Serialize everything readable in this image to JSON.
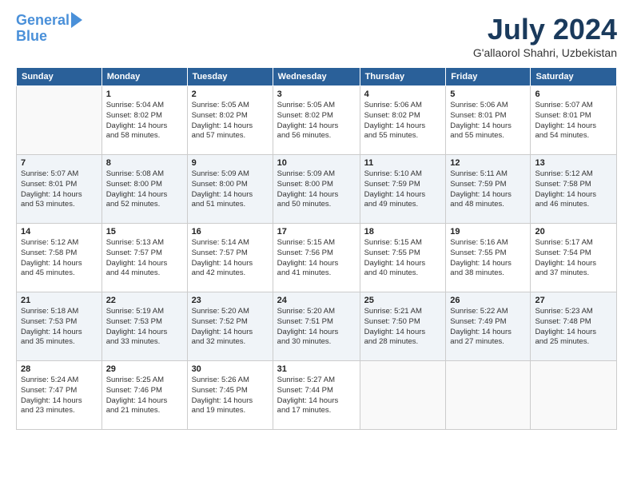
{
  "logo": {
    "line1": "General",
    "line2": "Blue"
  },
  "title": "July 2024",
  "location": "G'allaorol Shahri, Uzbekistan",
  "headers": [
    "Sunday",
    "Monday",
    "Tuesday",
    "Wednesday",
    "Thursday",
    "Friday",
    "Saturday"
  ],
  "weeks": [
    [
      {
        "day": "",
        "info": ""
      },
      {
        "day": "1",
        "info": "Sunrise: 5:04 AM\nSunset: 8:02 PM\nDaylight: 14 hours\nand 58 minutes."
      },
      {
        "day": "2",
        "info": "Sunrise: 5:05 AM\nSunset: 8:02 PM\nDaylight: 14 hours\nand 57 minutes."
      },
      {
        "day": "3",
        "info": "Sunrise: 5:05 AM\nSunset: 8:02 PM\nDaylight: 14 hours\nand 56 minutes."
      },
      {
        "day": "4",
        "info": "Sunrise: 5:06 AM\nSunset: 8:02 PM\nDaylight: 14 hours\nand 55 minutes."
      },
      {
        "day": "5",
        "info": "Sunrise: 5:06 AM\nSunset: 8:01 PM\nDaylight: 14 hours\nand 55 minutes."
      },
      {
        "day": "6",
        "info": "Sunrise: 5:07 AM\nSunset: 8:01 PM\nDaylight: 14 hours\nand 54 minutes."
      }
    ],
    [
      {
        "day": "7",
        "info": "Sunrise: 5:07 AM\nSunset: 8:01 PM\nDaylight: 14 hours\nand 53 minutes."
      },
      {
        "day": "8",
        "info": "Sunrise: 5:08 AM\nSunset: 8:00 PM\nDaylight: 14 hours\nand 52 minutes."
      },
      {
        "day": "9",
        "info": "Sunrise: 5:09 AM\nSunset: 8:00 PM\nDaylight: 14 hours\nand 51 minutes."
      },
      {
        "day": "10",
        "info": "Sunrise: 5:09 AM\nSunset: 8:00 PM\nDaylight: 14 hours\nand 50 minutes."
      },
      {
        "day": "11",
        "info": "Sunrise: 5:10 AM\nSunset: 7:59 PM\nDaylight: 14 hours\nand 49 minutes."
      },
      {
        "day": "12",
        "info": "Sunrise: 5:11 AM\nSunset: 7:59 PM\nDaylight: 14 hours\nand 48 minutes."
      },
      {
        "day": "13",
        "info": "Sunrise: 5:12 AM\nSunset: 7:58 PM\nDaylight: 14 hours\nand 46 minutes."
      }
    ],
    [
      {
        "day": "14",
        "info": "Sunrise: 5:12 AM\nSunset: 7:58 PM\nDaylight: 14 hours\nand 45 minutes."
      },
      {
        "day": "15",
        "info": "Sunrise: 5:13 AM\nSunset: 7:57 PM\nDaylight: 14 hours\nand 44 minutes."
      },
      {
        "day": "16",
        "info": "Sunrise: 5:14 AM\nSunset: 7:57 PM\nDaylight: 14 hours\nand 42 minutes."
      },
      {
        "day": "17",
        "info": "Sunrise: 5:15 AM\nSunset: 7:56 PM\nDaylight: 14 hours\nand 41 minutes."
      },
      {
        "day": "18",
        "info": "Sunrise: 5:15 AM\nSunset: 7:55 PM\nDaylight: 14 hours\nand 40 minutes."
      },
      {
        "day": "19",
        "info": "Sunrise: 5:16 AM\nSunset: 7:55 PM\nDaylight: 14 hours\nand 38 minutes."
      },
      {
        "day": "20",
        "info": "Sunrise: 5:17 AM\nSunset: 7:54 PM\nDaylight: 14 hours\nand 37 minutes."
      }
    ],
    [
      {
        "day": "21",
        "info": "Sunrise: 5:18 AM\nSunset: 7:53 PM\nDaylight: 14 hours\nand 35 minutes."
      },
      {
        "day": "22",
        "info": "Sunrise: 5:19 AM\nSunset: 7:53 PM\nDaylight: 14 hours\nand 33 minutes."
      },
      {
        "day": "23",
        "info": "Sunrise: 5:20 AM\nSunset: 7:52 PM\nDaylight: 14 hours\nand 32 minutes."
      },
      {
        "day": "24",
        "info": "Sunrise: 5:20 AM\nSunset: 7:51 PM\nDaylight: 14 hours\nand 30 minutes."
      },
      {
        "day": "25",
        "info": "Sunrise: 5:21 AM\nSunset: 7:50 PM\nDaylight: 14 hours\nand 28 minutes."
      },
      {
        "day": "26",
        "info": "Sunrise: 5:22 AM\nSunset: 7:49 PM\nDaylight: 14 hours\nand 27 minutes."
      },
      {
        "day": "27",
        "info": "Sunrise: 5:23 AM\nSunset: 7:48 PM\nDaylight: 14 hours\nand 25 minutes."
      }
    ],
    [
      {
        "day": "28",
        "info": "Sunrise: 5:24 AM\nSunset: 7:47 PM\nDaylight: 14 hours\nand 23 minutes."
      },
      {
        "day": "29",
        "info": "Sunrise: 5:25 AM\nSunset: 7:46 PM\nDaylight: 14 hours\nand 21 minutes."
      },
      {
        "day": "30",
        "info": "Sunrise: 5:26 AM\nSunset: 7:45 PM\nDaylight: 14 hours\nand 19 minutes."
      },
      {
        "day": "31",
        "info": "Sunrise: 5:27 AM\nSunset: 7:44 PM\nDaylight: 14 hours\nand 17 minutes."
      },
      {
        "day": "",
        "info": ""
      },
      {
        "day": "",
        "info": ""
      },
      {
        "day": "",
        "info": ""
      }
    ]
  ]
}
